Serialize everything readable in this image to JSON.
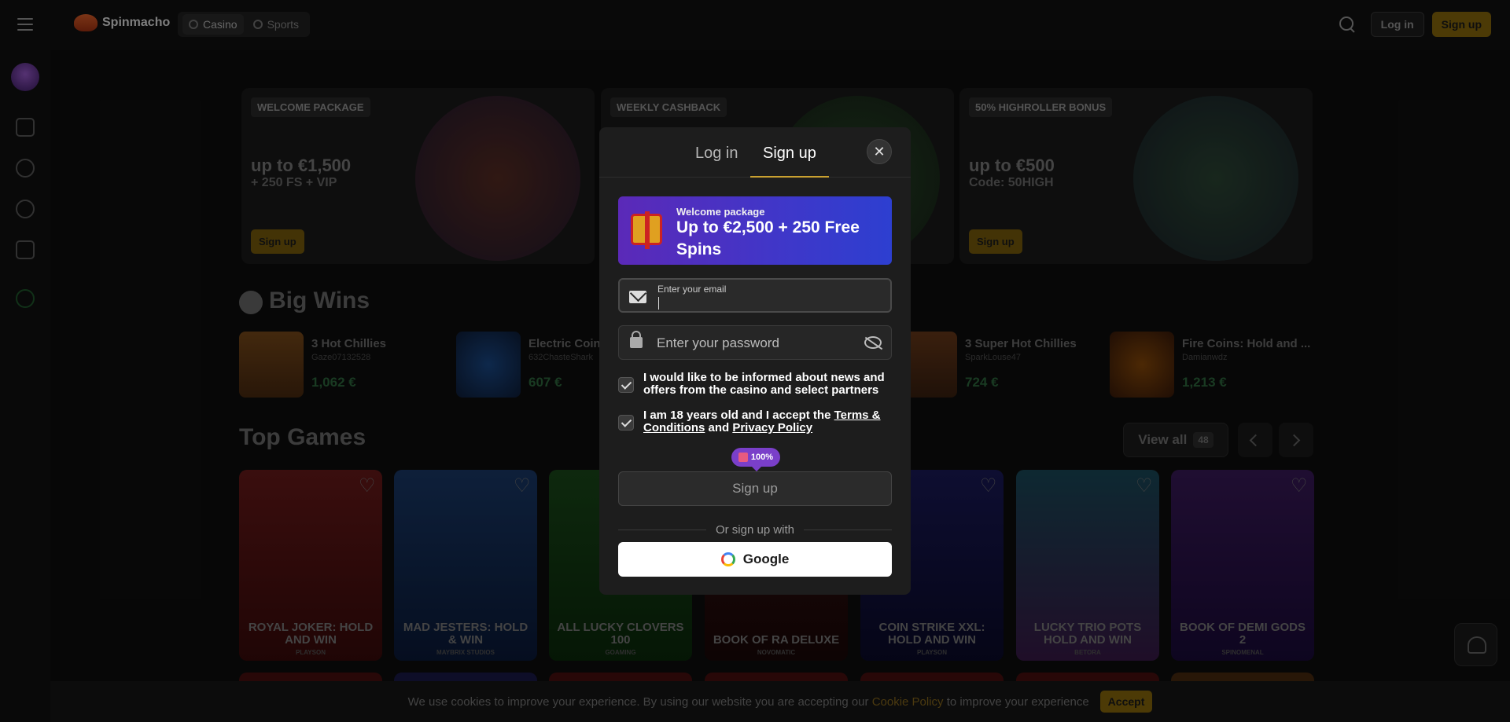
{
  "header": {
    "logo_text": "Spinmacho",
    "nav": [
      "Casino",
      "Sports"
    ],
    "login_label": "Log in",
    "signup_label": "Sign up"
  },
  "promos": [
    {
      "tag": "WELCOME PACKAGE",
      "big": "up to €1,500",
      "small": "+ 250 FS + VIP",
      "button": "Sign up"
    },
    {
      "tag": "WEEKLY CASHBACK",
      "big": "",
      "small": "",
      "button": ""
    },
    {
      "tag": "50% HIGHROLLER BONUS",
      "big": "up to €500",
      "small": "Code: 50HIGH",
      "button": "Sign up"
    }
  ],
  "big_wins": {
    "title": "Big Wins",
    "items": [
      {
        "game": "3 Hot Chillies",
        "user": "Gaze07132528",
        "amount": "1,062 €"
      },
      {
        "game": "Electric Coin",
        "user": "632ChasteShark",
        "amount": "607 €"
      },
      {
        "game": "3 Super Hot Chillies",
        "user": "SparkLouse47",
        "amount": "724 €"
      },
      {
        "game": "Fire Coins: Hold and ...",
        "user": "Damianwdz",
        "amount": "1,213 €"
      }
    ]
  },
  "top_games": {
    "title": "Top Games",
    "view_all": "View all",
    "count": "48",
    "games": [
      {
        "title": "ROYAL JOKER: HOLD AND WIN",
        "provider": "PLAYSON"
      },
      {
        "title": "MAD JESTERS: HOLD & WIN",
        "provider": "MAYBRIX STUDIOS"
      },
      {
        "title": "ALL LUCKY CLOVERS 100",
        "provider": "GOAMING"
      },
      {
        "title": "BOOK OF RA DELUXE",
        "provider": "NOVOMATIC"
      },
      {
        "title": "COIN STRIKE XXL: HOLD AND WIN",
        "provider": "PLAYSON"
      },
      {
        "title": "LUCKY TRIO POTS HOLD AND WIN",
        "provider": "BETORA"
      },
      {
        "title": "BOOK OF DEMI GODS 2",
        "provider": "SPINOMENAL"
      }
    ]
  },
  "cookie": {
    "text_before": "We use cookies to improve your experience. By using our website you are accepting our",
    "link": "Cookie Policy",
    "text_after": "to improve your experience",
    "accept": "Accept"
  },
  "modal": {
    "tab_login": "Log in",
    "tab_signup": "Sign up",
    "close": "✕",
    "banner_title": "Welcome package",
    "banner_offer": "Up to €2,500 + 250 Free Spins",
    "email_label": "Enter your email",
    "password_placeholder": "Enter your password",
    "consent_news": "I would like to be informed about news and offers from the casino and select partners",
    "consent_age_prefix": "I am 18 years old and I accept the",
    "terms_link": "Terms & Conditions",
    "and_word": "and",
    "privacy_link": "Privacy Policy",
    "bonus_percent": "100%",
    "submit": "Sign up",
    "divider": "Or sign up with",
    "google": "Google"
  }
}
